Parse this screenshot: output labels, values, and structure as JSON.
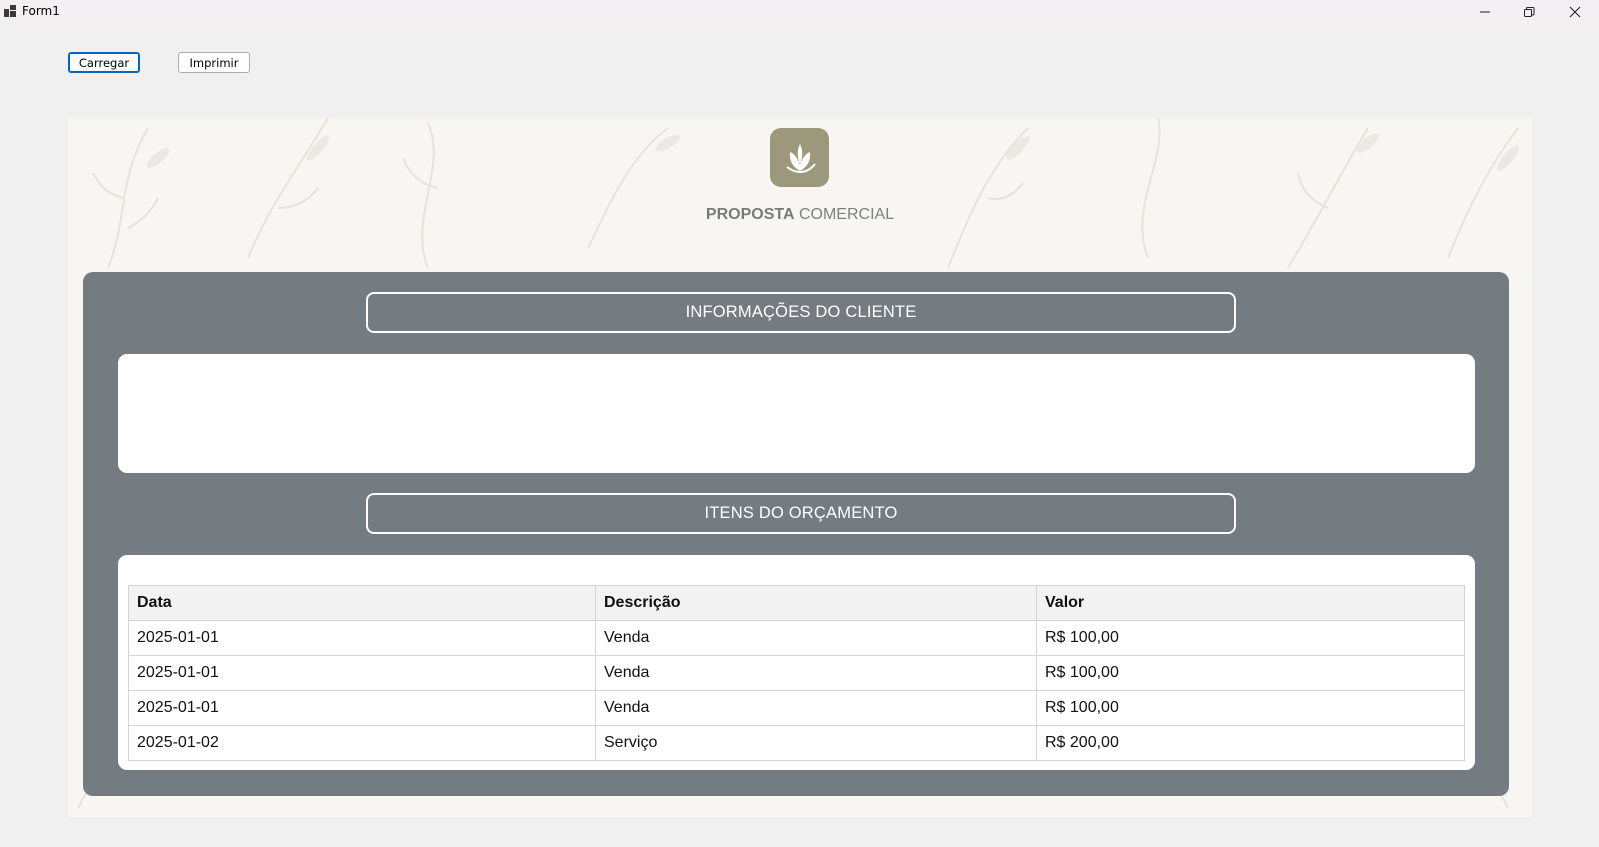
{
  "window": {
    "title": "Form1"
  },
  "toolbar": {
    "load_label": "Carregar",
    "print_label": "Imprimir"
  },
  "document": {
    "title_bold": "PROPOSTA",
    "title_rest": "COMERCIAL",
    "client_section": {
      "heading": "INFORMAÇÕES DO CLIENTE"
    },
    "items_section": {
      "heading": "ITENS DO ORÇAMENTO",
      "columns": [
        "Data",
        "Descrição",
        "Valor"
      ],
      "rows": [
        [
          "2025-01-01",
          "Venda",
          "R$ 100,00"
        ],
        [
          "2025-01-01",
          "Venda",
          "R$ 100,00"
        ],
        [
          "2025-01-01",
          "Venda",
          "R$ 100,00"
        ],
        [
          "2025-01-02",
          "Serviço",
          "R$ 200,00"
        ]
      ]
    }
  },
  "colors": {
    "panel": "#747b81",
    "logo_bg": "#9c987b",
    "focus_border": "#0067c0"
  },
  "icons": {
    "app": "form-app-icon",
    "logo": "flower-logo-icon",
    "minimize": "minimize-icon",
    "maximize": "restore-icon",
    "close": "close-icon"
  }
}
